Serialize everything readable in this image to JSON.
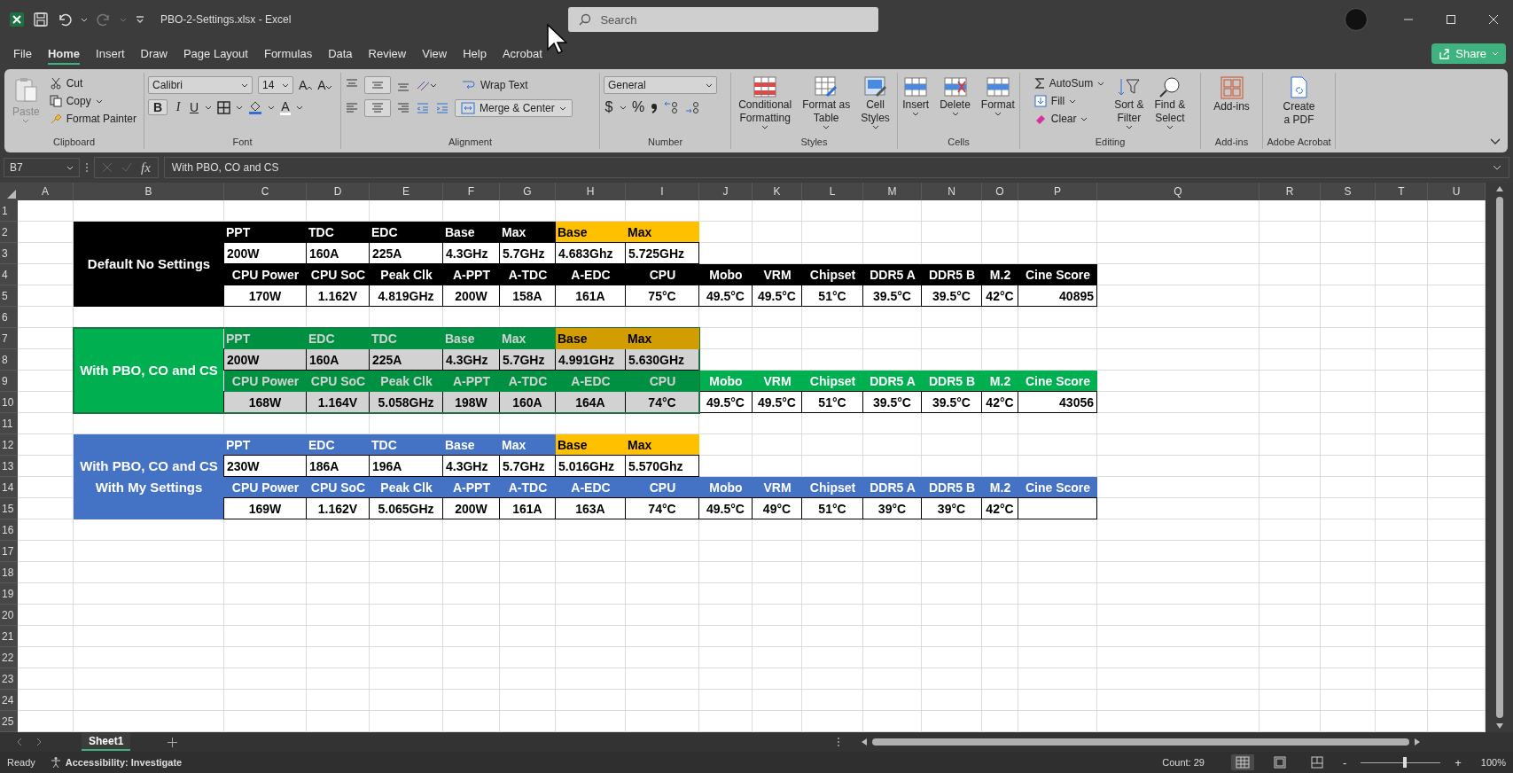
{
  "title_bar": {
    "file_name": "PBO-2-Settings.xlsx  -  Excel",
    "search": {
      "placeholder": "Search"
    }
  },
  "menu_tabs": [
    {
      "label": "File",
      "selected": false
    },
    {
      "label": "Home",
      "selected": true
    },
    {
      "label": "Insert",
      "selected": false
    },
    {
      "label": "Draw",
      "selected": false
    },
    {
      "label": "Page Layout",
      "selected": false
    },
    {
      "label": "Formulas",
      "selected": false
    },
    {
      "label": "Data",
      "selected": false
    },
    {
      "label": "Review",
      "selected": false
    },
    {
      "label": "View",
      "selected": false
    },
    {
      "label": "Help",
      "selected": false
    },
    {
      "label": "Acrobat",
      "selected": false
    }
  ],
  "share_button": "Share",
  "ribbon": {
    "clipboard": {
      "label": "Clipboard",
      "paste": {
        "label": "Paste",
        "disabled": true
      },
      "cut": "Cut",
      "copy": "Copy",
      "format_painter": "Format Painter"
    },
    "font": {
      "label": "Font",
      "font_name": "Calibri",
      "font_size": "14",
      "grow": "A",
      "shrink": "A",
      "bold": "B",
      "italic": "I",
      "underline": "U",
      "font_color": "A"
    },
    "alignment": {
      "label": "Alignment",
      "wrap_text": "Wrap Text",
      "merge_center": "Merge & Center"
    },
    "number": {
      "label": "Number",
      "format": "General",
      "currency": "$",
      "percent": "%"
    },
    "styles": {
      "label": "Styles",
      "items": [
        [
          "Conditional",
          "Formatting"
        ],
        [
          "Format as",
          "Table"
        ],
        [
          "Cell",
          "Styles"
        ]
      ]
    },
    "cells": {
      "label": "Cells",
      "items": [
        "Insert",
        "Delete",
        "Format"
      ]
    },
    "editing": {
      "label": "Editing",
      "autosum": "AutoSum",
      "fill": "Fill",
      "clear": "Clear",
      "sort": [
        "Sort &",
        "Filter"
      ],
      "find": [
        "Find &",
        "Select"
      ]
    },
    "addins": {
      "label": "Add-ins",
      "button": "Add-ins"
    },
    "acrobat": {
      "label": "Adobe Acrobat",
      "button": [
        "Create",
        "a PDF"
      ]
    }
  },
  "formula_bar": {
    "name_box": "B7",
    "fx": "fx",
    "value": "With PBO, CO and CS"
  },
  "sheet": {
    "columns": [
      "A",
      "B",
      "C",
      "D",
      "E",
      "F",
      "G",
      "H",
      "I",
      "J",
      "K",
      "L",
      "M",
      "N",
      "O",
      "P",
      "Q",
      "R",
      "S",
      "T",
      "U"
    ],
    "rows": [
      "1",
      "2",
      "3",
      "4",
      "5",
      "6",
      "7",
      "8",
      "9",
      "10",
      "11",
      "12",
      "13",
      "14",
      "15",
      "16",
      "17",
      "18",
      "19",
      "20",
      "21",
      "22",
      "23",
      "24",
      "25"
    ],
    "blocks": [
      {
        "label_lines": [
          "Default No Settings"
        ],
        "color": "#000000",
        "selected": false,
        "settings_headers": [
          {
            "text": "PPT",
            "highlight": false
          },
          {
            "text": "TDC",
            "highlight": false
          },
          {
            "text": "EDC",
            "highlight": false
          },
          {
            "text": "Base",
            "highlight": false
          },
          {
            "text": "Max",
            "highlight": false
          },
          {
            "text": "Base",
            "highlight": true
          },
          {
            "text": "Max",
            "highlight": true
          }
        ],
        "settings_values": [
          "200W",
          "160A",
          "225A",
          "4.3GHz",
          "5.7GHz",
          "4.683Ghz",
          "5.725GHz"
        ],
        "result_headers": [
          "CPU Power",
          "CPU SoC",
          "Peak Clk",
          "A-PPT",
          "A-TDC",
          "A-EDC",
          "CPU",
          "Mobo",
          "VRM",
          "Chipset",
          "DDR5 A",
          "DDR5 B",
          "M.2",
          "Cine Score"
        ],
        "result_values": [
          "170W",
          "1.162V",
          "4.819GHz",
          "200W",
          "158A",
          "161A",
          "75°C",
          "49.5°C",
          "49.5°C",
          "51°C",
          "39.5°C",
          "39.5°C",
          "42°C",
          "40895"
        ]
      },
      {
        "label_lines": [
          "With PBO, CO and CS"
        ],
        "color": "#00b050",
        "selected": true,
        "settings_headers": [
          {
            "text": "PPT",
            "highlight": false
          },
          {
            "text": "EDC",
            "highlight": false
          },
          {
            "text": "TDC",
            "highlight": false
          },
          {
            "text": "Base",
            "highlight": false
          },
          {
            "text": "Max",
            "highlight": false
          },
          {
            "text": "Base",
            "highlight": true
          },
          {
            "text": "Max",
            "highlight": true
          }
        ],
        "settings_values": [
          "200W",
          "160A",
          "225A",
          "4.3GHz",
          "5.7GHz",
          "4.991GHz",
          "5.630GHz"
        ],
        "result_headers": [
          "CPU Power",
          "CPU SoC",
          "Peak Clk",
          "A-PPT",
          "A-TDC",
          "A-EDC",
          "CPU",
          "Mobo",
          "VRM",
          "Chipset",
          "DDR5 A",
          "DDR5 B",
          "M.2",
          "Cine Score"
        ],
        "result_values": [
          "168W",
          "1.164V",
          "5.058GHz",
          "198W",
          "160A",
          "164A",
          "74°C",
          "49.5°C",
          "49.5°C",
          "51°C",
          "39.5°C",
          "39.5°C",
          "42°C",
          "43056"
        ]
      },
      {
        "label_lines": [
          "With PBO, CO and CS",
          "With My Settings"
        ],
        "color": "#4472c4",
        "selected": false,
        "settings_headers": [
          {
            "text": "PPT",
            "highlight": false
          },
          {
            "text": "EDC",
            "highlight": false
          },
          {
            "text": "TDC",
            "highlight": false
          },
          {
            "text": "Base",
            "highlight": false
          },
          {
            "text": "Max",
            "highlight": false
          },
          {
            "text": "Base",
            "highlight": true
          },
          {
            "text": "Max",
            "highlight": true
          }
        ],
        "settings_values": [
          "230W",
          "186A",
          "196A",
          "4.3GHz",
          "5.7GHz",
          "5.016GHz",
          "5.570Ghz"
        ],
        "result_headers": [
          "CPU Power",
          "CPU SoC",
          "Peak Clk",
          "A-PPT",
          "A-TDC",
          "A-EDC",
          "CPU",
          "Mobo",
          "VRM",
          "Chipset",
          "DDR5 A",
          "DDR5 B",
          "M.2",
          "Cine Score"
        ],
        "result_values": [
          "169W",
          "1.162V",
          "5.065GHz",
          "200W",
          "161A",
          "163A",
          "74°C",
          "49.5°C",
          "49°C",
          "51°C",
          "39°C",
          "39°C",
          "42°C"
        ]
      }
    ]
  },
  "sheet_tabs": [
    {
      "label": "Sheet1",
      "selected": true
    }
  ],
  "status_bar": {
    "mode": "Ready",
    "accessibility": "Accessibility: Investigate",
    "count": "Count: 29",
    "zoom_out": "-",
    "zoom_in": "+",
    "zoom_percent": "100%",
    "zoom": {
      "level": 0.55
    }
  }
}
